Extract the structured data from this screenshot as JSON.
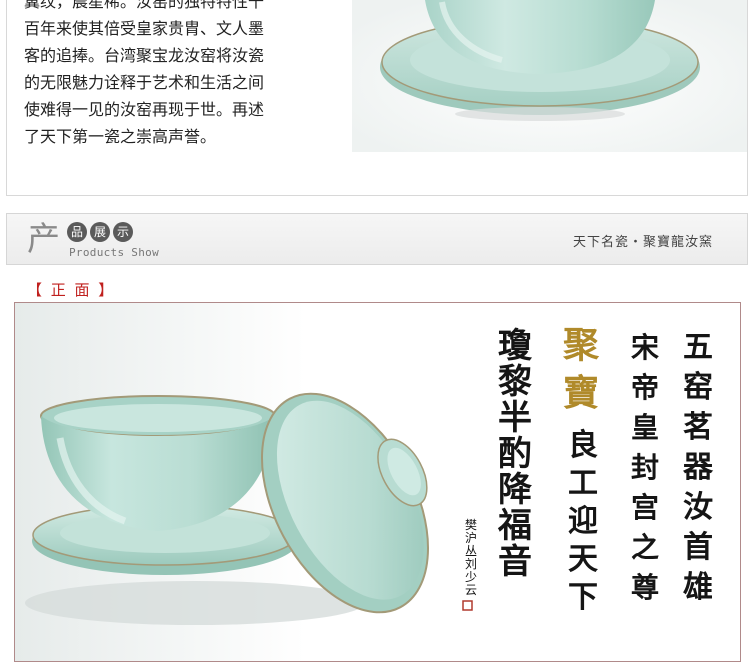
{
  "intro": {
    "lines": [
      "翼纹，晨星稀。汝窑的独特特性千",
      "百年来使其倍受皇家贵胄、文人墨",
      "客的追捧。台湾聚宝龙汝窑将汝瓷",
      "的无限魅力诠释于艺术和生活之间",
      "使难得一见的汝窑再现于世。再述",
      "了天下第一瓷之崇高声誉。"
    ]
  },
  "section": {
    "big_char": "产",
    "circle_chars": [
      "品",
      "展",
      "示"
    ],
    "english": "Products Show",
    "right_text": "天下名瓷・聚寶龍汝窯"
  },
  "front_label": "【 正 面 】",
  "calligraphy": {
    "col1": "五窑茗器汝首雄",
    "col2": "宋帝皇封宫之尊",
    "col3_gold": "聚寶",
    "col3": "良工迎天下",
    "col4": "瓊黎半酌降福音",
    "signature": "樊沪丛刘少云"
  },
  "colors": {
    "celadon": "#b8dcd2",
    "celadon_dark": "#8fc4b5",
    "crackle_rim": "#a89a78",
    "ink": "#151515",
    "gold": "#b08a2a",
    "seal_red": "#b03a2e"
  }
}
